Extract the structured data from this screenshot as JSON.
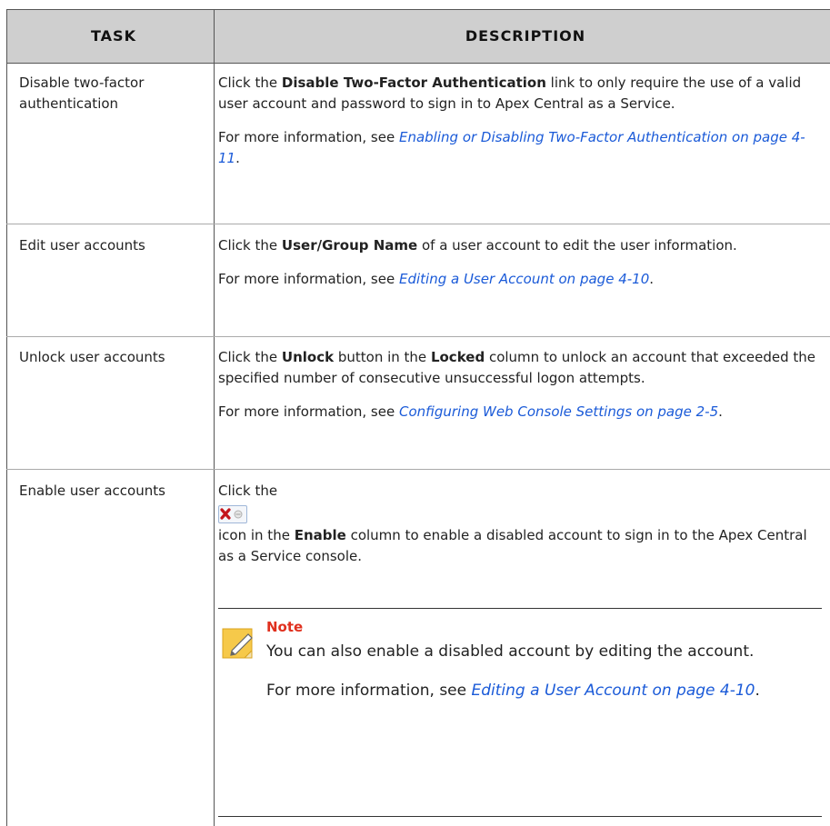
{
  "table": {
    "headers": {
      "task": "Task",
      "description": "Description"
    },
    "rows": [
      {
        "task": "Disable two-factor authentication",
        "desc": {
          "p1_pre": "Click the ",
          "p1_bold": "Disable Two-Factor Authentication",
          "p1_post": " link to only require the use of a valid user account and password to sign in to Apex Central as a Service.",
          "p2_pre": "For more information, see ",
          "p2_link": "Enabling or Disabling Two-Factor Authentication on page 4-11",
          "p2_post": "."
        }
      },
      {
        "task": "Edit user accounts",
        "desc": {
          "p1_pre": "Click the ",
          "p1_bold": "User/Group Name",
          "p1_post": " of a user account to edit the user information.",
          "p2_pre": "For more information, see ",
          "p2_link": "Editing a User Account on page 4-10",
          "p2_post": "."
        }
      },
      {
        "task": "Unlock user accounts",
        "desc": {
          "p1_pre": "Click the ",
          "p1_bold": "Unlock",
          "p1_mid": " button in the ",
          "p1_bold2": "Locked",
          "p1_post": " column to unlock an account that exceeded the specified number of consecutive unsuccessful logon attempts.",
          "p2_pre": "For more information, see ",
          "p2_link": "Configuring Web Console Settings on page 2-5",
          "p2_post": "."
        }
      },
      {
        "task": "Enable user accounts",
        "desc": {
          "p1_pre": "Click the",
          "p1_icon": "disabled-x-icon",
          "p2_pre": "icon in the ",
          "p2_bold": "Enable",
          "p2_post": " column to enable a disabled account to sign in to the Apex Central as a Service console."
        },
        "note": {
          "icon": "note-pencil-icon",
          "title": "Note",
          "body1": "You can also enable a disabled account by editing the account.",
          "body2_pre": "For more information, see ",
          "body2_link": "Editing a User Account on page 4-10",
          "body2_post": "."
        }
      }
    ]
  },
  "colors": {
    "header_bg": "#cfcfcf",
    "link": "#1a5ad8",
    "note_title": "#e0301e"
  }
}
